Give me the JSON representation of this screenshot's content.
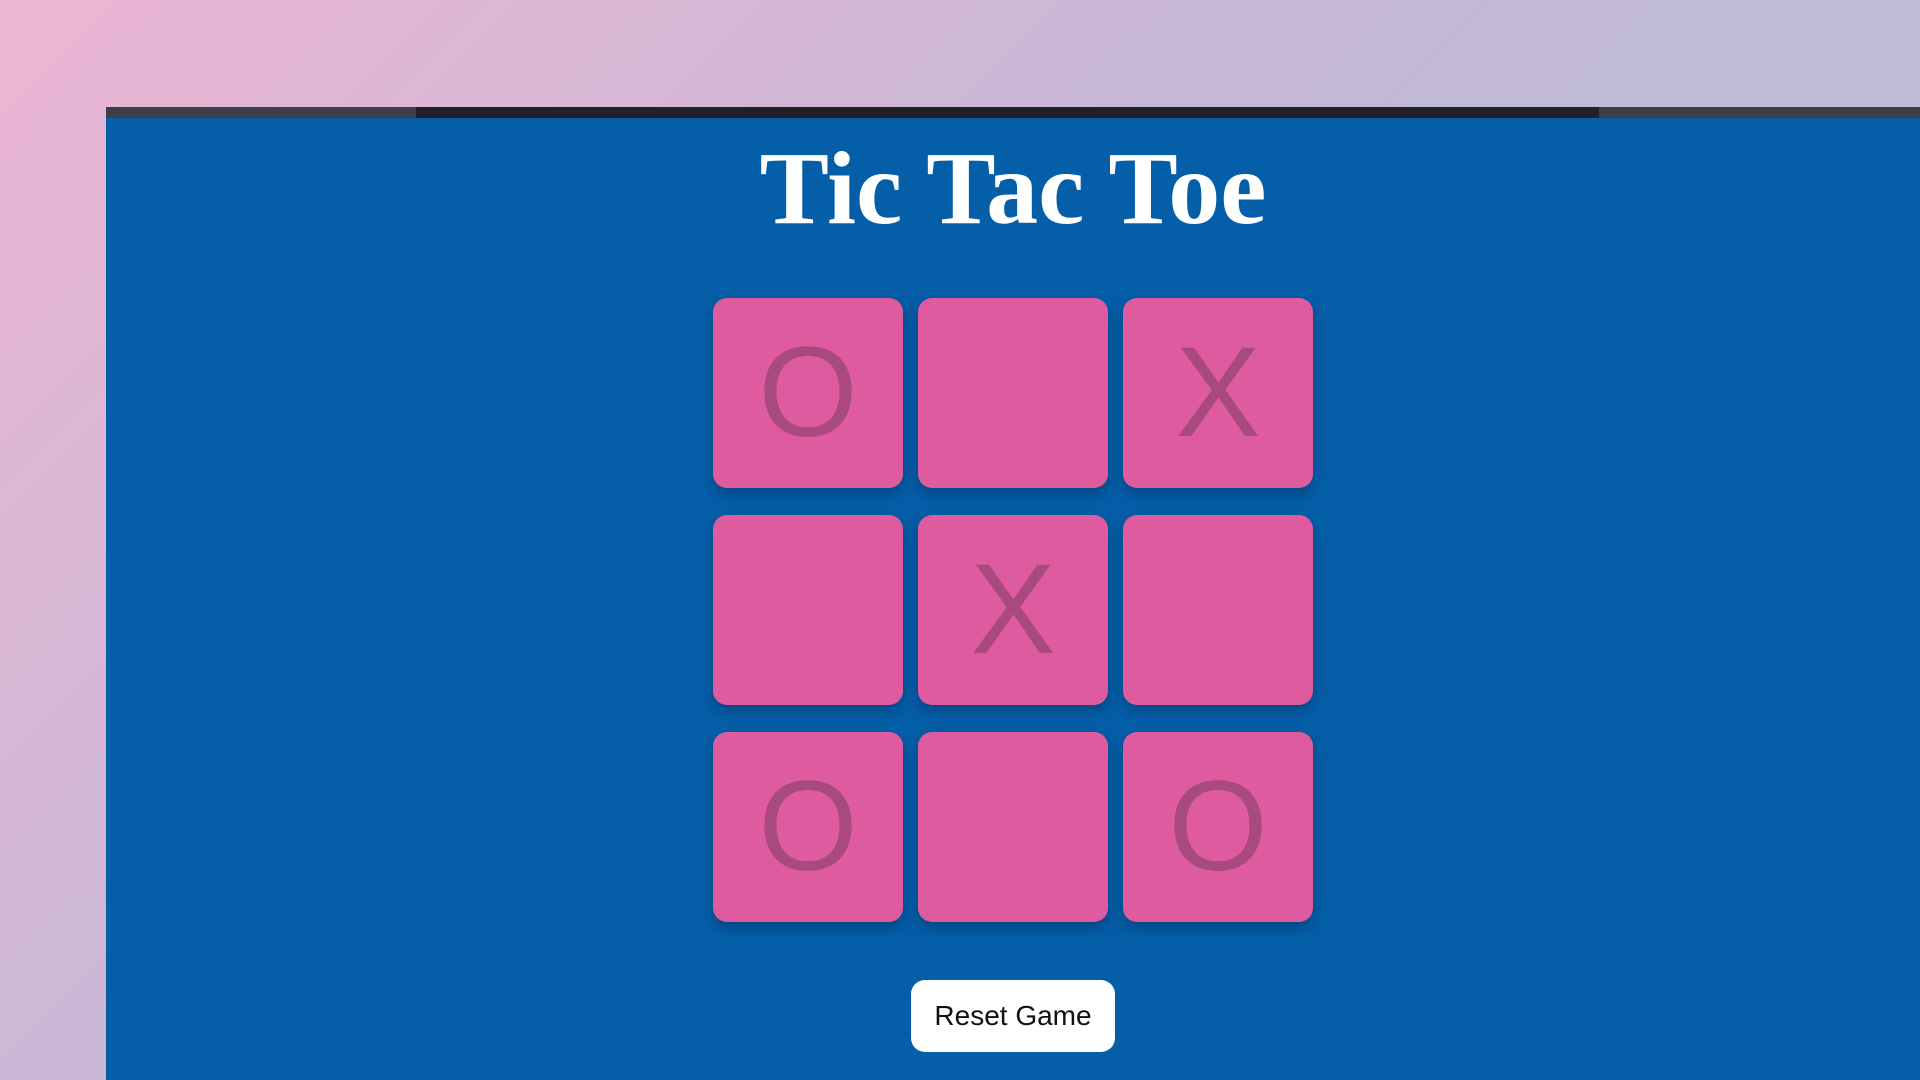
{
  "game": {
    "title": "Tic Tac Toe",
    "board": [
      [
        "O",
        "",
        "X"
      ],
      [
        "",
        "X",
        ""
      ],
      [
        "O",
        "",
        "O"
      ]
    ],
    "reset_label": "Reset Game"
  },
  "colors": {
    "desktop_gradient": [
      "#ecb6d4",
      "#b4c0dc"
    ],
    "page_background": "#055fa8",
    "cell_background": "#de5b9f",
    "mark_color": "#a8497f",
    "button_background": "#ffffff"
  }
}
